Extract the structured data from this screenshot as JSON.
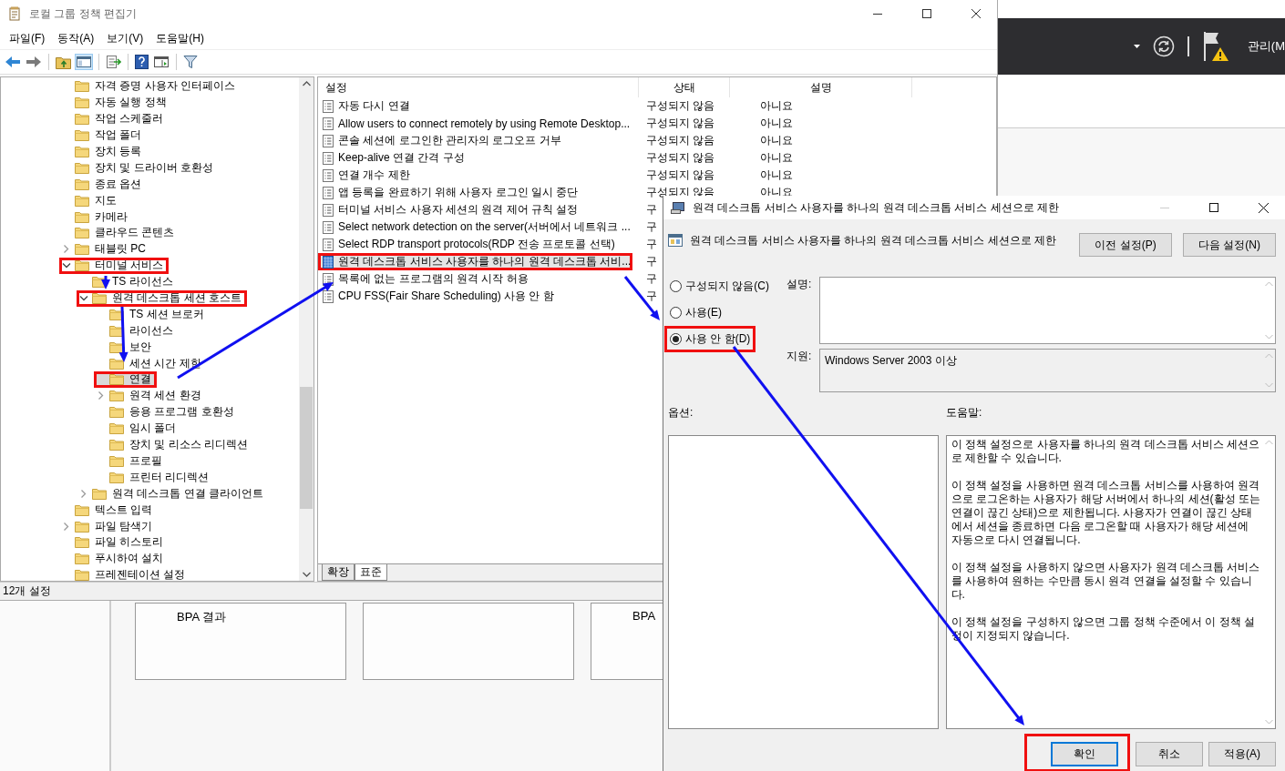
{
  "server_manager": {
    "menu_label": "관리(M",
    "tiles": [
      {
        "kind": "tile",
        "title": "BPA 결과"
      },
      {
        "kind": "tile"
      },
      {
        "kind": "tile",
        "title": "BPA"
      }
    ]
  },
  "main_window": {
    "title": "로컬 그룹 정책 편집기",
    "menu": [
      "파일(F)",
      "동작(A)",
      "보기(V)",
      "도움말(H)"
    ],
    "tree": {
      "items": [
        {
          "label": "자격 증명 사용자 인터페이스",
          "expandable": false,
          "selected": false,
          "annotated": false
        },
        {
          "label": "자동 실행 정책",
          "expandable": false,
          "selected": false,
          "annotated": false
        },
        {
          "label": "작업 스케줄러",
          "expandable": false,
          "selected": false,
          "annotated": false
        },
        {
          "label": "작업 폴더",
          "expandable": false,
          "selected": false,
          "annotated": false
        },
        {
          "label": "장치 등록",
          "expandable": false,
          "selected": false,
          "annotated": false
        },
        {
          "label": "장치 및 드라이버 호환성",
          "expandable": false,
          "selected": false,
          "annotated": false
        },
        {
          "label": "종료 옵션",
          "expandable": false,
          "selected": false,
          "annotated": false
        },
        {
          "label": "지도",
          "expandable": false,
          "selected": false,
          "annotated": false
        },
        {
          "label": "카메라",
          "expandable": false,
          "selected": false,
          "annotated": false
        },
        {
          "label": "클라우드 콘텐츠",
          "expandable": false,
          "selected": false,
          "annotated": false
        },
        {
          "label": "태블릿 PC",
          "expandable": true,
          "expanded": false,
          "selected": false,
          "annotated": false
        },
        {
          "label": "터미널 서비스",
          "expandable": true,
          "expanded": true,
          "selected": false,
          "annotated": true,
          "children": [
            {
              "label": "TS 라이선스",
              "expandable": false,
              "selected": false,
              "annotated": false
            },
            {
              "label": "원격 데스크톱 세션 호스트",
              "expandable": true,
              "expanded": true,
              "selected": false,
              "annotated": true,
              "children": [
                {
                  "label": "TS 세션 브로커",
                  "expandable": false,
                  "selected": false,
                  "annotated": false
                },
                {
                  "label": "라이선스",
                  "expandable": false,
                  "selected": false,
                  "annotated": false
                },
                {
                  "label": "보안",
                  "expandable": false,
                  "selected": false,
                  "annotated": false
                },
                {
                  "label": "세션 시간 제한",
                  "expandable": false,
                  "selected": false,
                  "annotated": false
                },
                {
                  "label": "연결",
                  "expandable": false,
                  "selected": true,
                  "annotated": true
                },
                {
                  "label": "원격 세션 환경",
                  "expandable": true,
                  "expanded": false,
                  "selected": false,
                  "annotated": false
                },
                {
                  "label": "응용 프로그램 호환성",
                  "expandable": false,
                  "selected": false,
                  "annotated": false
                },
                {
                  "label": "임시 폴더",
                  "expandable": false,
                  "selected": false,
                  "annotated": false
                },
                {
                  "label": "장치 및 리소스 리디렉션",
                  "expandable": false,
                  "selected": false,
                  "annotated": false
                },
                {
                  "label": "프로필",
                  "expandable": false,
                  "selected": false,
                  "annotated": false
                },
                {
                  "label": "프린터 리디렉션",
                  "expandable": false,
                  "selected": false,
                  "annotated": false
                }
              ]
            },
            {
              "label": "원격 데스크톱 연결 클라이언트",
              "expandable": true,
              "expanded": false,
              "selected": false,
              "annotated": false
            }
          ]
        },
        {
          "label": "텍스트 입력",
          "expandable": false,
          "selected": false,
          "annotated": false
        },
        {
          "label": "파일 탐색기",
          "expandable": true,
          "expanded": false,
          "selected": false,
          "annotated": false
        },
        {
          "label": "파일 히스토리",
          "expandable": false,
          "selected": false,
          "annotated": false
        },
        {
          "label": "푸시하여 설치",
          "expandable": false,
          "selected": false,
          "annotated": false
        },
        {
          "label": "프레젠테이션 설정",
          "expandable": false,
          "selected": false,
          "annotated": false
        }
      ]
    },
    "settings": {
      "columns": [
        "설정",
        "상태",
        "설명"
      ],
      "rows": [
        {
          "name": "자동 다시 연결",
          "state": "구성되지 않음",
          "comment": "아니요",
          "selected": false,
          "annotated": false
        },
        {
          "name": "Allow users to connect remotely by using Remote Desktop...",
          "state": "구성되지 않음",
          "comment": "아니요",
          "selected": false,
          "annotated": false
        },
        {
          "name": "콘솔 세션에 로그인한 관리자의 로그오프 거부",
          "state": "구성되지 않음",
          "comment": "아니요",
          "selected": false,
          "annotated": false
        },
        {
          "name": "Keep-alive 연결 간격 구성",
          "state": "구성되지 않음",
          "comment": "아니요",
          "selected": false,
          "annotated": false
        },
        {
          "name": "연결 개수 제한",
          "state": "구성되지 않음",
          "comment": "아니요",
          "selected": false,
          "annotated": false
        },
        {
          "name": "앱 등록을 완료하기 위해 사용자 로그인 일시 중단",
          "state": "구성되지 않음",
          "comment": "아니요",
          "selected": false,
          "annotated": false
        },
        {
          "name": "터미널 서비스 사용자 세션의 원격 제어 규칙 설정",
          "state": "구",
          "selected": false,
          "annotated": false
        },
        {
          "name": "Select network detection on the server(서버에서 네트워크 ...",
          "state": "구",
          "selected": false,
          "annotated": false
        },
        {
          "name": "Select RDP transport protocols(RDP 전송 프로토콜 선택)",
          "state": "구",
          "selected": false,
          "annotated": false
        },
        {
          "name": "원격 데스크톱 서비스 사용자를 하나의 원격 데스크톱 서비...",
          "state": "구",
          "selected": true,
          "annotated": true
        },
        {
          "name": "목록에 없는 프로그램의 원격 시작 허용",
          "state": "구",
          "selected": false,
          "annotated": false
        },
        {
          "name": "CPU FSS(Fair Share Scheduling) 사용 안 함",
          "state": "구",
          "selected": false,
          "annotated": false
        }
      ],
      "tabs": [
        {
          "label": "확장",
          "selected": false
        },
        {
          "label": "표준",
          "selected": true
        }
      ]
    },
    "status_bar": "12개 설정"
  },
  "dialog": {
    "title": "원격 데스크톱 서비스 사용자를 하나의 원격 데스크톱 서비스 세션으로 제한",
    "heading": "원격 데스크톱 서비스 사용자를 하나의 원격 데스크톱 서비스 세션으로 제한",
    "nav_buttons": [
      "이전 설정(P)",
      "다음 설정(N)"
    ],
    "options": [
      {
        "label": "구성되지 않음(C)",
        "selected": false,
        "annotated": false
      },
      {
        "label": "사용(E)",
        "selected": false,
        "annotated": false
      },
      {
        "label": "사용 안 함(D)",
        "selected": true,
        "annotated": true
      }
    ],
    "comment_label": "설명:",
    "supported_label": "지원:",
    "supported_on": "Windows Server 2003 이상",
    "options_label": "옵션:",
    "help_label": "도움말:",
    "help": [
      "이 정책 설정으로 사용자를 하나의 원격 데스크톱 서비스 세션으로 제한할 수 있습니다.",
      "이 정책 설정을 사용하면 원격 데스크톱 서비스를 사용하여 원격으로 로그온하는 사용자가 해당 서버에서 하나의 세션(활성 또는 연결이 끊긴 상태)으로 제한됩니다. 사용자가 연결이 끊긴 상태에서 세션을 종료하면 다음 로그온할 때 사용자가 해당 세션에 자동으로 다시 연결됩니다.",
      "이 정책 설정을 사용하지 않으면 사용자가 원격 데스크톱 서비스를 사용하여 원하는 수만큼 동시 원격 연결을 설정할 수 있습니다.",
      "이 정책 설정을 구성하지 않으면 그룹 정책 수준에서 이 정책 설정이 지정되지 않습니다."
    ],
    "buttons": [
      {
        "label": "확인",
        "default": true,
        "annotated": true
      },
      {
        "label": "취소",
        "default": false,
        "annotated": false
      },
      {
        "label": "적용(A)",
        "default": false,
        "annotated": false
      }
    ]
  }
}
